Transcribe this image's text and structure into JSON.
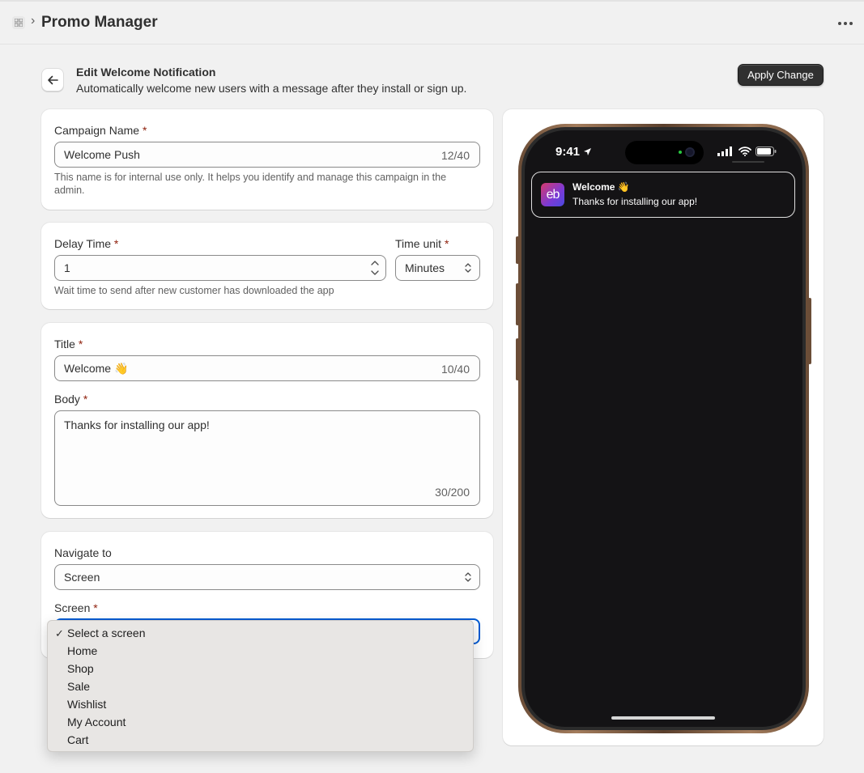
{
  "header": {
    "app_name": "Promo Manager",
    "breadcrumb_separator": "›"
  },
  "page": {
    "title": "Edit Welcome Notification",
    "subtitle": "Automatically welcome new users with a message after they install or sign up.",
    "apply_label": "Apply Change"
  },
  "campaign": {
    "label": "Campaign Name",
    "required_mark": "*",
    "value": "Welcome Push",
    "count": "12/40",
    "help": "This name is for internal use only. It helps you identify and manage this campaign in the admin."
  },
  "delay": {
    "label": "Delay Time",
    "value": "1",
    "unit_label": "Time unit",
    "unit_value": "Minutes",
    "help": "Wait time to send after new customer has downloaded the app"
  },
  "content": {
    "title_label": "Title",
    "title_value": "Welcome 👋",
    "title_count": "10/40",
    "body_label": "Body",
    "body_value": "Thanks for installing our app!",
    "body_count": "30/200"
  },
  "navigation": {
    "navigate_label": "Navigate to",
    "navigate_value": "Screen",
    "screen_label": "Screen",
    "check_mark": "✓",
    "options": [
      "Select a screen",
      "Home",
      "Shop",
      "Sale",
      "Wishlist",
      "My Account",
      "Cart"
    ],
    "selected_index": 0
  },
  "preview": {
    "time": "9:41",
    "notification_icon_text": "eb",
    "notification_title": "Welcome 👋",
    "notification_body": "Thanks for installing our app!"
  },
  "colors": {
    "primary_button": "#303030",
    "required": "#8e1f0b",
    "focus": "#005bd3",
    "page_bg": "#f1f1f1"
  }
}
